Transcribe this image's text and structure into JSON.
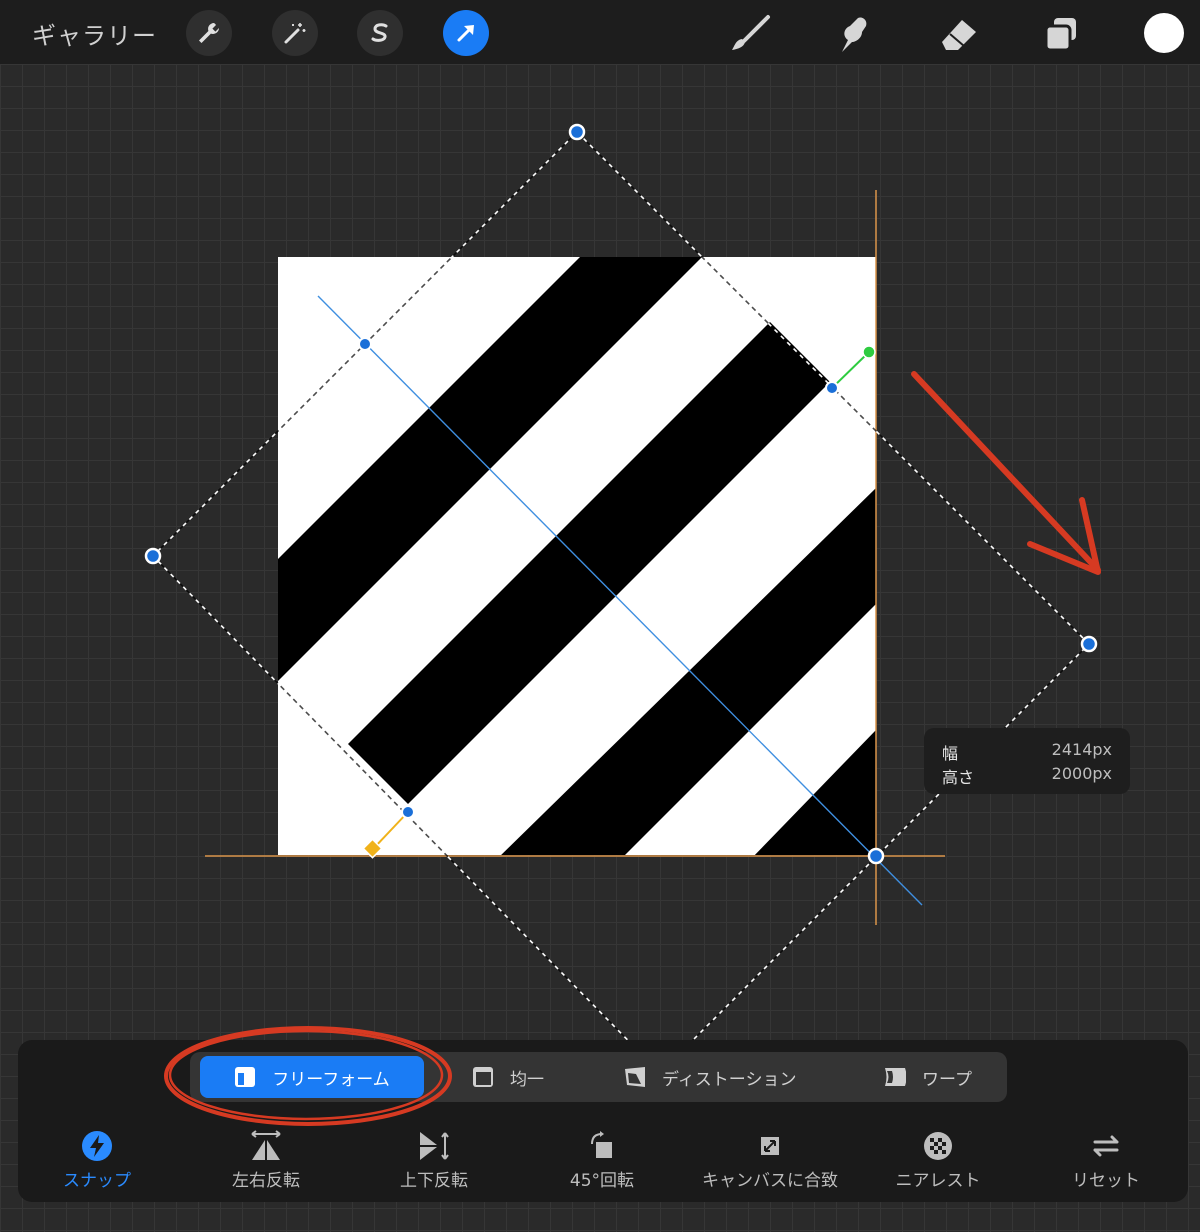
{
  "topbar": {
    "gallery_label": "ギャラリー",
    "left_tools": [
      "wrench-icon",
      "magic-wand-icon",
      "selection-s-icon",
      "transform-arrow-icon"
    ],
    "active_tool": "transform-arrow-icon",
    "right_tools": [
      "brush-icon",
      "smudge-icon",
      "eraser-icon",
      "layers-icon"
    ],
    "current_color": "#ffffff"
  },
  "dimensions": {
    "width_label": "幅",
    "width_value": "2414px",
    "height_label": "高さ",
    "height_value": "2000px"
  },
  "modes": {
    "items": [
      {
        "label": "フリーフォーム",
        "icon": "freeform-icon"
      },
      {
        "label": "均一",
        "icon": "uniform-icon"
      },
      {
        "label": "ディストーション",
        "icon": "distort-icon"
      },
      {
        "label": "ワープ",
        "icon": "warp-icon"
      }
    ],
    "selected": "フリーフォーム"
  },
  "bottom_actions": [
    {
      "label": "スナップ",
      "icon": "snap-bolt-icon"
    },
    {
      "label": "左右反転",
      "icon": "flip-horizontal-icon"
    },
    {
      "label": "上下反転",
      "icon": "flip-vertical-icon"
    },
    {
      "label": "45°回転",
      "icon": "rotate-45-icon"
    },
    {
      "label": "キャンバスに合致",
      "icon": "fit-canvas-icon"
    },
    {
      "label": "ニアレスト",
      "icon": "nearest-icon"
    },
    {
      "label": "リセット",
      "icon": "reset-icon"
    }
  ],
  "colors": {
    "accent": "#1a7cf5",
    "annotation": "#d63a22",
    "rotation_handle": "#2ecc40",
    "pivot_handle": "#f0b21a",
    "guide_orange": "#d9944a"
  }
}
